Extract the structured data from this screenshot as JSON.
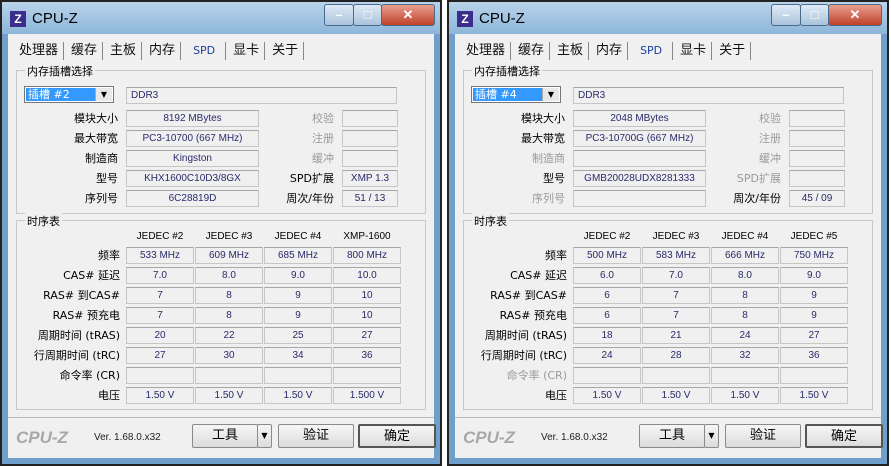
{
  "windows": [
    {
      "title": "CPU-Z",
      "tabs": [
        "处理器",
        "缓存",
        "主板",
        "内存",
        "SPD",
        "显卡",
        "关于"
      ],
      "active_tab": "SPD",
      "slot_group": "内存插槽选择",
      "slot": "插槽 #2",
      "type": "DDR3",
      "rows": [
        {
          "label": "模块大小",
          "value": "8192 MBytes",
          "rlabel": "校验",
          "rvalue": "",
          "dim": false,
          "rdim": true
        },
        {
          "label": "最大带宽",
          "value": "PC3-10700 (667 MHz)",
          "rlabel": "注册",
          "rvalue": "",
          "dim": false,
          "rdim": true
        },
        {
          "label": "制造商",
          "value": "Kingston",
          "rlabel": "缓冲",
          "rvalue": "",
          "dim": false,
          "rdim": true
        },
        {
          "label": "型号",
          "value": "KHX1600C10D3/8GX",
          "rlabel": "SPD扩展",
          "rvalue": "XMP 1.3",
          "dim": false,
          "rdim": false
        },
        {
          "label": "序列号",
          "value": "6C28819D",
          "rlabel": "周次/年份",
          "rvalue": "51 / 13",
          "dim": false,
          "rdim": false
        }
      ],
      "timing_group": "时序表",
      "columns": [
        "JEDEC #2",
        "JEDEC #3",
        "JEDEC #4",
        "XMP-1600"
      ],
      "timings": [
        {
          "label": "频率",
          "values": [
            "533 MHz",
            "609 MHz",
            "685 MHz",
            "800 MHz"
          ],
          "dim": false
        },
        {
          "label": "CAS# 延迟",
          "values": [
            "7.0",
            "8.0",
            "9.0",
            "10.0"
          ],
          "dim": false
        },
        {
          "label": "RAS# 到CAS#",
          "values": [
            "7",
            "8",
            "9",
            "10"
          ],
          "dim": false
        },
        {
          "label": "RAS# 预充电",
          "values": [
            "7",
            "8",
            "9",
            "10"
          ],
          "dim": false
        },
        {
          "label": "周期时间 (tRAS)",
          "values": [
            "20",
            "22",
            "25",
            "27"
          ],
          "dim": false
        },
        {
          "label": "行周期时间 (tRC)",
          "values": [
            "27",
            "30",
            "34",
            "36"
          ],
          "dim": false
        },
        {
          "label": "命令率 (CR)",
          "values": [
            "",
            "",
            "",
            ""
          ],
          "dim": false
        },
        {
          "label": "电压",
          "values": [
            "1.50 V",
            "1.50 V",
            "1.50 V",
            "1.500 V"
          ],
          "dim": false
        }
      ],
      "footer": {
        "logo": "CPU-Z",
        "version": "Ver. 1.68.0.x32",
        "tools": "工具",
        "validate": "验证",
        "ok": "确定"
      }
    },
    {
      "title": "CPU-Z",
      "tabs": [
        "处理器",
        "缓存",
        "主板",
        "内存",
        "SPD",
        "显卡",
        "关于"
      ],
      "active_tab": "SPD",
      "slot_group": "内存插槽选择",
      "slot": "插槽 #4",
      "type": "DDR3",
      "rows": [
        {
          "label": "模块大小",
          "value": "2048 MBytes",
          "rlabel": "校验",
          "rvalue": "",
          "dim": false,
          "rdim": true
        },
        {
          "label": "最大带宽",
          "value": "PC3-10700G (667 MHz)",
          "rlabel": "注册",
          "rvalue": "",
          "dim": false,
          "rdim": true
        },
        {
          "label": "制造商",
          "value": "",
          "rlabel": "缓冲",
          "rvalue": "",
          "dim": true,
          "rdim": true
        },
        {
          "label": "型号",
          "value": "GMB20028UDX8281333",
          "rlabel": "SPD扩展",
          "rvalue": "",
          "dim": false,
          "rdim": true
        },
        {
          "label": "序列号",
          "value": "",
          "rlabel": "周次/年份",
          "rvalue": "45 / 09",
          "dim": true,
          "rdim": false
        }
      ],
      "timing_group": "时序表",
      "columns": [
        "JEDEC #2",
        "JEDEC #3",
        "JEDEC #4",
        "JEDEC #5"
      ],
      "timings": [
        {
          "label": "频率",
          "values": [
            "500 MHz",
            "583 MHz",
            "666 MHz",
            "750 MHz"
          ],
          "dim": false
        },
        {
          "label": "CAS# 延迟",
          "values": [
            "6.0",
            "7.0",
            "8.0",
            "9.0"
          ],
          "dim": false
        },
        {
          "label": "RAS# 到CAS#",
          "values": [
            "6",
            "7",
            "8",
            "9"
          ],
          "dim": false
        },
        {
          "label": "RAS# 预充电",
          "values": [
            "6",
            "7",
            "8",
            "9"
          ],
          "dim": false
        },
        {
          "label": "周期时间 (tRAS)",
          "values": [
            "18",
            "21",
            "24",
            "27"
          ],
          "dim": false
        },
        {
          "label": "行周期时间 (tRC)",
          "values": [
            "24",
            "28",
            "32",
            "36"
          ],
          "dim": false
        },
        {
          "label": "命令率 (CR)",
          "values": [
            "",
            "",
            "",
            ""
          ],
          "dim": true
        },
        {
          "label": "电压",
          "values": [
            "1.50 V",
            "1.50 V",
            "1.50 V",
            "1.50 V"
          ],
          "dim": false
        }
      ],
      "footer": {
        "logo": "CPU-Z",
        "version": "Ver. 1.68.0.x32",
        "tools": "工具",
        "validate": "验证",
        "ok": "确定"
      }
    }
  ]
}
